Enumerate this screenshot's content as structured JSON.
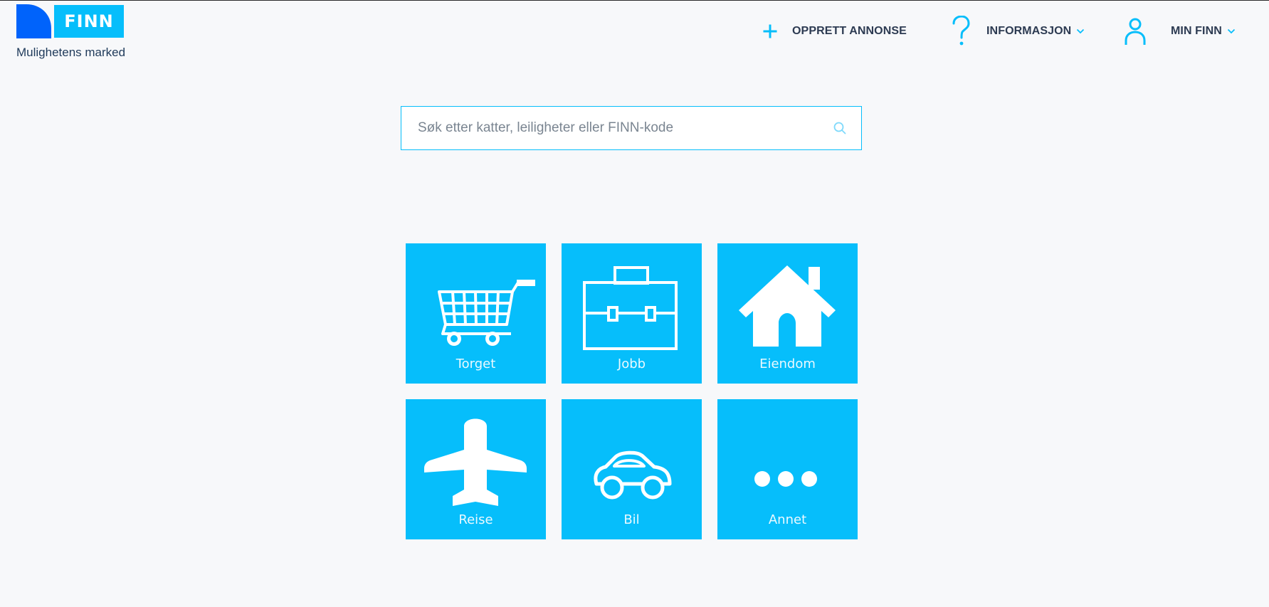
{
  "brand": {
    "logo_text": "FINN",
    "tagline": "Mulighetens marked",
    "accent_color": "#06befb",
    "logo_shape_color": "#0063fb"
  },
  "nav": {
    "create_ad": {
      "label": "OPPRETT ANNONSE",
      "icon": "plus-icon"
    },
    "info": {
      "label": "INFORMASJON",
      "icon": "question-icon"
    },
    "account": {
      "label": "MIN FINN",
      "icon": "user-icon"
    }
  },
  "search": {
    "placeholder": "Søk etter katter, leiligheter eller FINN-kode",
    "value": "",
    "icon": "search-icon"
  },
  "categories": [
    {
      "label": "Torget",
      "icon": "shopping-cart-icon"
    },
    {
      "label": "Jobb",
      "icon": "briefcase-icon"
    },
    {
      "label": "Eiendom",
      "icon": "house-icon"
    },
    {
      "label": "Reise",
      "icon": "airplane-icon"
    },
    {
      "label": "Bil",
      "icon": "car-icon"
    },
    {
      "label": "Annet",
      "icon": "more-icon"
    }
  ]
}
